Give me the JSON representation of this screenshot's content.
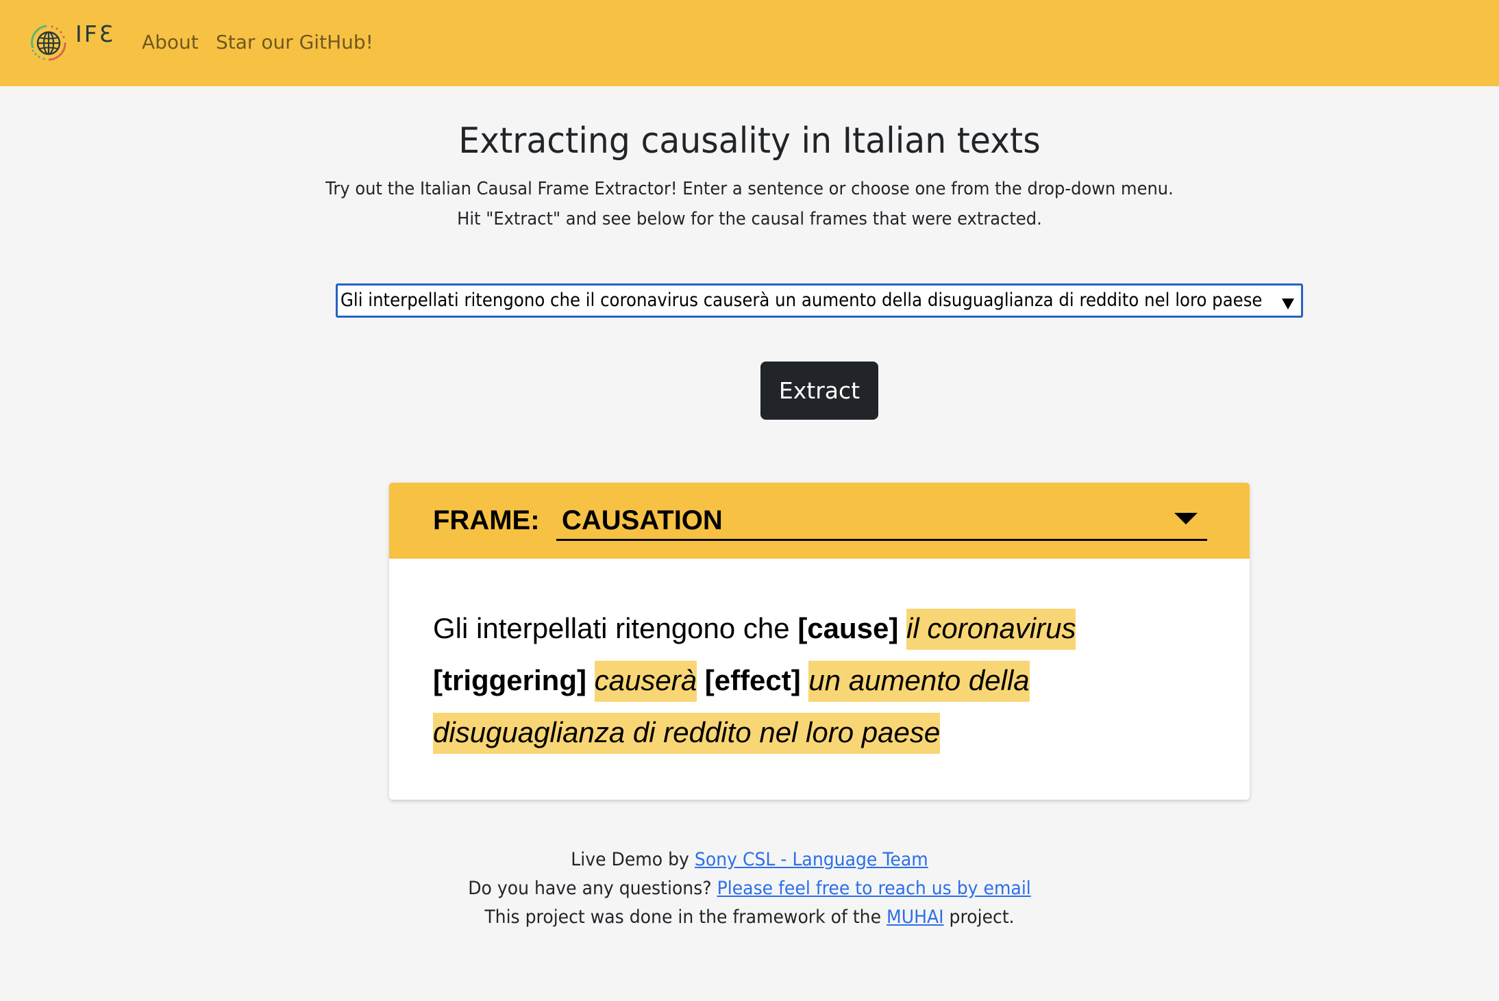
{
  "navbar": {
    "logo_text": "IFƐ",
    "logo_icon": "globe-icon",
    "links": [
      {
        "label": "About"
      },
      {
        "label": "Star our GitHub!"
      }
    ],
    "background_color": "#f7c243"
  },
  "header": {
    "title": "Extracting causality in Italian texts",
    "subtitle_line1": "Try out the Italian Causal Frame Extractor! Enter a sentence or choose one from the drop-down menu.",
    "subtitle_line2": "Hit \"Extract\" and see below for the causal frames that were extracted."
  },
  "sentence_select": {
    "value": "Gli interpellati ritengono che il coronavirus causerà un aumento della disuguaglianza di reddito nel loro paese",
    "arrow_icon": "caret-down-icon",
    "border_color": "#2462c6"
  },
  "extract_button": {
    "label": "Extract"
  },
  "frame_card": {
    "label": "FRAME:",
    "selected_frame": "CAUSATION",
    "highlight_color": "#f9d675",
    "sentence": {
      "prefix": "Gli interpellati ritengono che ",
      "cause_role": "[cause]",
      "cause_text": "il coronavirus",
      "trigger_role": "[triggering]",
      "trigger_text": "causerà",
      "effect_role": "[effect]",
      "effect_text": "un aumento della disuguaglianza di reddito nel loro paese"
    }
  },
  "footer": {
    "line1_text": "Live Demo by ",
    "line1_link": "Sony CSL - Language Team",
    "line2_text": "Do you have any questions? ",
    "line2_link": "Please feel free to reach us by email",
    "line3_text_before": "This project was done in the framework of the ",
    "line3_link": "MUHAI",
    "line3_text_after": " project.",
    "link_color": "#2b6fe8"
  }
}
